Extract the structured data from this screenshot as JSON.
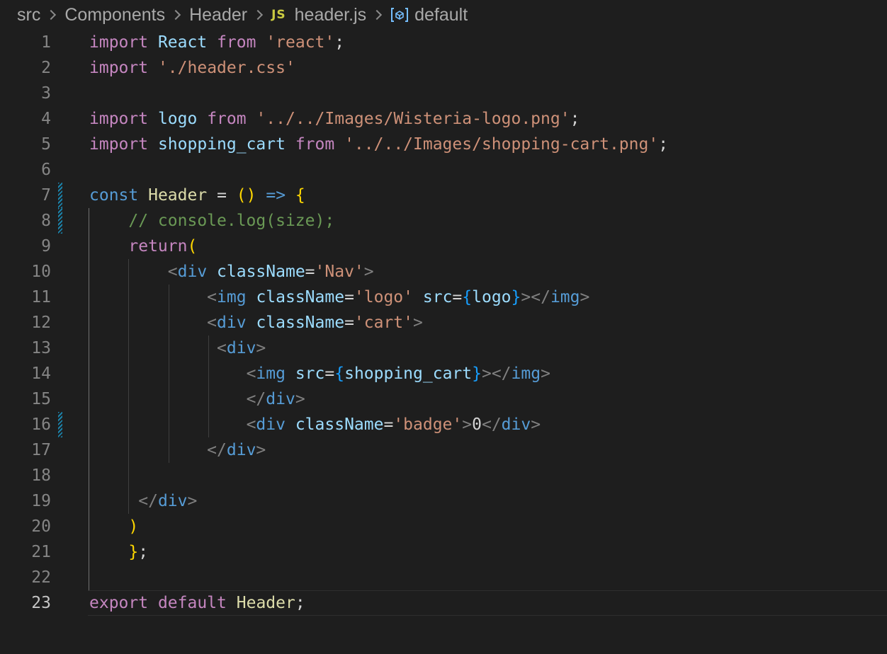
{
  "breadcrumb": {
    "items": [
      "src",
      "Components",
      "Header",
      "header.js",
      "default"
    ],
    "file_icon_text": "JS",
    "symbol_icon": "symbol-variable-icon"
  },
  "editor": {
    "language": "javascript",
    "active_line": 23,
    "line_numbers": [
      "1",
      "2",
      "3",
      "4",
      "5",
      "6",
      "7",
      "8",
      "9",
      "10",
      "11",
      "12",
      "13",
      "14",
      "15",
      "16",
      "17",
      "18",
      "19",
      "20",
      "21",
      "22",
      "23"
    ],
    "lines": [
      "import React from 'react';",
      "import './header.css'",
      "",
      "import logo from '../../Images/Wisteria-logo.png';",
      "import shopping_cart from '../../Images/shopping-cart.png';",
      "",
      "const Header = () => {",
      "    // console.log(size);",
      "    return(",
      "        <div className='Nav'>",
      "            <img className='logo' src={logo}></img>",
      "            <div className='cart'>",
      "             <div>",
      "                <img src={shopping_cart}></img>",
      "                </div>",
      "                <div className='badge'>0</div>",
      "            </div>",
      "",
      "     </div>",
      "    )",
      "    };",
      "",
      "export default Header;"
    ],
    "modified_lines": [
      7,
      8,
      16
    ]
  },
  "colors": {
    "background": "#1e1e1e",
    "keyword": "#c586c0",
    "string": "#ce9178",
    "variable": "#9cdcfe",
    "function": "#dcdcaa",
    "declaration": "#569cd6",
    "comment": "#6a9955",
    "modified_gutter": "#1b81a8"
  }
}
